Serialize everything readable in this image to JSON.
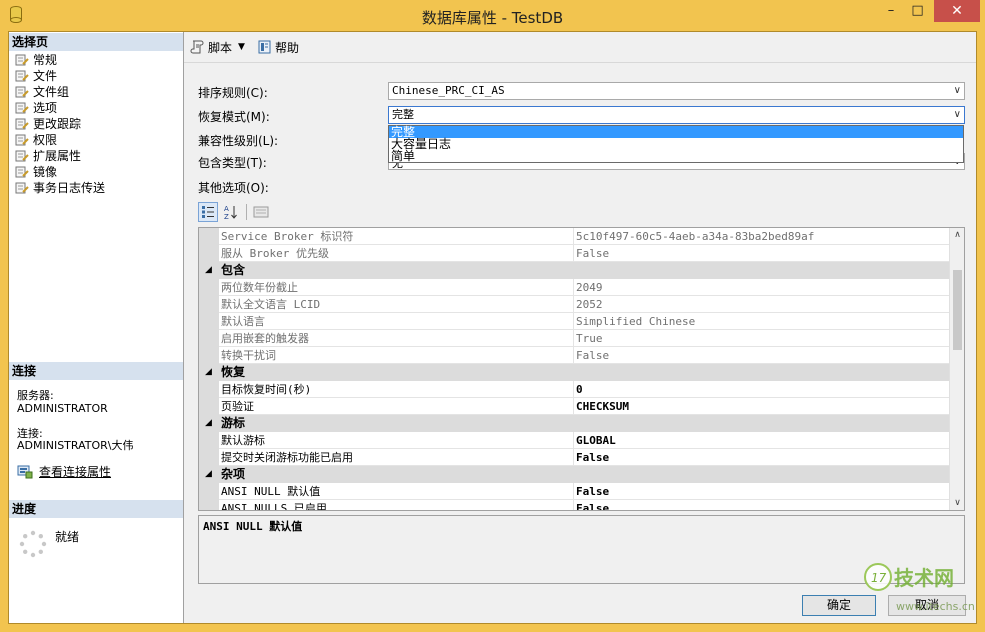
{
  "window": {
    "title": "数据库属性 - TestDB",
    "min_glyph": "–",
    "max_glyph": "□",
    "close_glyph": "✕"
  },
  "left": {
    "select_page_header": "选择页",
    "nav_items": [
      {
        "label": "常规"
      },
      {
        "label": "文件"
      },
      {
        "label": "文件组"
      },
      {
        "label": "选项"
      },
      {
        "label": "更改跟踪"
      },
      {
        "label": "权限"
      },
      {
        "label": "扩展属性"
      },
      {
        "label": "镜像"
      },
      {
        "label": "事务日志传送"
      }
    ],
    "connection_header": "连接",
    "server_label": "服务器:",
    "server_value": "ADMINISTRATOR",
    "connection_label": "连接:",
    "connection_value": "ADMINISTRATOR\\大伟",
    "view_connection_link": "查看连接属性",
    "progress_header": "进度",
    "progress_status": "就绪"
  },
  "toolbar": {
    "script_label": "脚本",
    "help_label": "帮助"
  },
  "form": {
    "collation_label": "排序规则(C):",
    "collation_value": "Chinese_PRC_CI_AS",
    "recovery_label": "恢复模式(M):",
    "recovery_value": "完整",
    "compat_label": "兼容性级别(L):",
    "containment_label": "包含类型(T):",
    "containment_value": "无",
    "other_options_label": "其他选项(O):",
    "recovery_options": [
      {
        "label": "完整",
        "selected": true
      },
      {
        "label": "大容量日志",
        "selected": false
      },
      {
        "label": "简单",
        "selected": false
      }
    ]
  },
  "grid": {
    "rows": [
      {
        "type": "prop",
        "name": "Service Broker 标识符",
        "value": "5c10f497-60c5-4aeb-a34a-83ba2bed89af",
        "readonly": true
      },
      {
        "type": "prop",
        "name": "服从 Broker 优先级",
        "value": "False",
        "readonly": true
      },
      {
        "type": "cat",
        "name": "包含"
      },
      {
        "type": "prop",
        "name": "两位数年份截止",
        "value": "2049",
        "readonly": true
      },
      {
        "type": "prop",
        "name": "默认全文语言 LCID",
        "value": "2052",
        "readonly": true
      },
      {
        "type": "prop",
        "name": "默认语言",
        "value": "Simplified Chinese",
        "readonly": true
      },
      {
        "type": "prop",
        "name": "启用嵌套的触发器",
        "value": "True",
        "readonly": true
      },
      {
        "type": "prop",
        "name": "转换干扰词",
        "value": "False",
        "readonly": true
      },
      {
        "type": "cat",
        "name": "恢复"
      },
      {
        "type": "prop",
        "name": "目标恢复时间(秒)",
        "value": "0",
        "readonly": false
      },
      {
        "type": "prop",
        "name": "页验证",
        "value": "CHECKSUM",
        "readonly": false
      },
      {
        "type": "cat",
        "name": "游标"
      },
      {
        "type": "prop",
        "name": "默认游标",
        "value": "GLOBAL",
        "readonly": false
      },
      {
        "type": "prop",
        "name": "提交时关闭游标功能已启用",
        "value": "False",
        "readonly": false
      },
      {
        "type": "cat",
        "name": "杂项"
      },
      {
        "type": "prop",
        "name": "ANSI NULL 默认值",
        "value": "False",
        "readonly": false
      },
      {
        "type": "prop",
        "name": "ANSI NULLS 已启用",
        "value": "False",
        "readonly": false
      }
    ],
    "description": "ANSI NULL 默认值"
  },
  "buttons": {
    "ok": "确定",
    "cancel": "取消"
  },
  "watermark": {
    "text": "技术网",
    "url": "www.itechs.cn",
    "badge": "17"
  },
  "colors": {
    "title_frame": "#f2c44f",
    "close_button": "#c7504a",
    "section_header": "#d6e1ee",
    "selection_blue": "#3399ff",
    "category_gray": "#dcdcdc"
  }
}
